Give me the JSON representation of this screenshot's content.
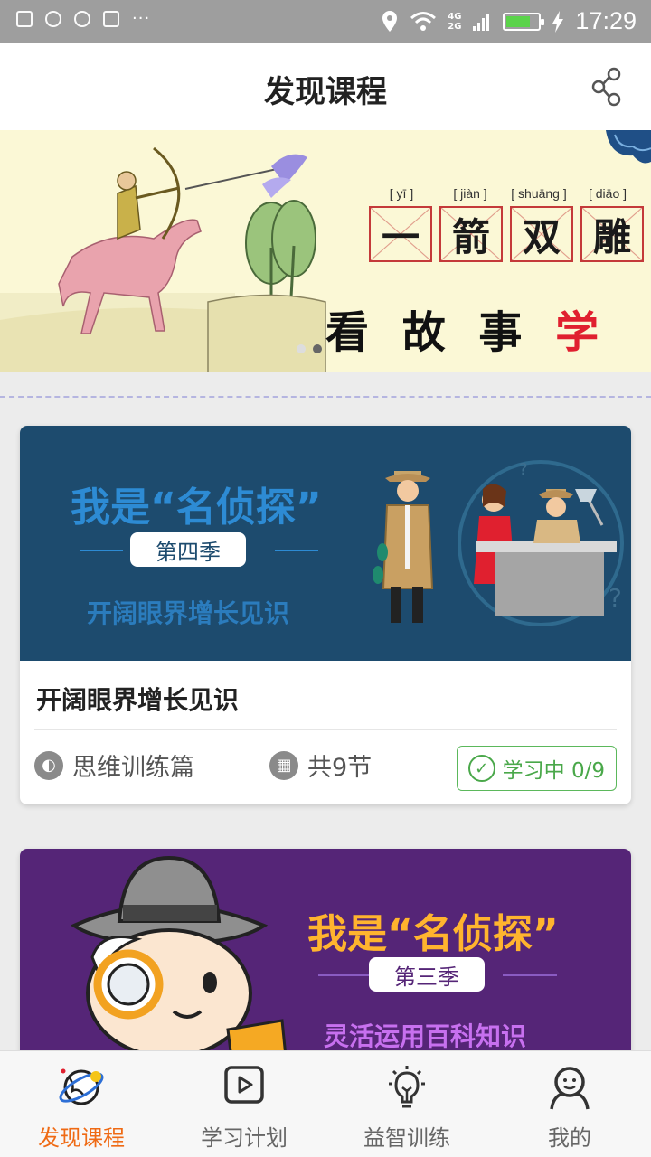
{
  "status_bar": {
    "network": "4G\n2G",
    "time": "17:29",
    "battery_level": 0.75
  },
  "header": {
    "title": "发现课程"
  },
  "banner": {
    "pinyin": [
      "[ yī ]",
      "[ jiàn ]",
      "[ shuāng ]",
      "[ diāo ]"
    ],
    "idiom": [
      "一",
      "箭",
      "双",
      "雕"
    ],
    "slogan_black": "看 故 事 ",
    "slogan_red": "学 成 语",
    "active_slide": 2,
    "total_slides": 2
  },
  "courses": [
    {
      "cover_title": "我是“名侦探”",
      "cover_season": "第四季",
      "cover_subtitle": "开阔眼界增长见识",
      "title": "开阔眼界增长见识",
      "category": "思维训练篇",
      "lessons": "共9节",
      "status": "学习中 0/9"
    },
    {
      "cover_title": "我是“名侦探”",
      "cover_season": "第三季",
      "cover_subtitle": "灵活运用百科知识"
    }
  ],
  "bottom_nav": {
    "items": [
      {
        "label": "发现课程",
        "icon": "planet-icon",
        "active": true
      },
      {
        "label": "学习计划",
        "icon": "play-icon",
        "active": false
      },
      {
        "label": "益智训练",
        "icon": "bulb-icon",
        "active": false
      },
      {
        "label": "我的",
        "icon": "user-icon",
        "active": false
      }
    ]
  },
  "colors": {
    "accent": "#ef6a14",
    "status_green": "#4aa84a",
    "card1_bg": "#1d4b6e",
    "card2_bg": "#552577"
  }
}
